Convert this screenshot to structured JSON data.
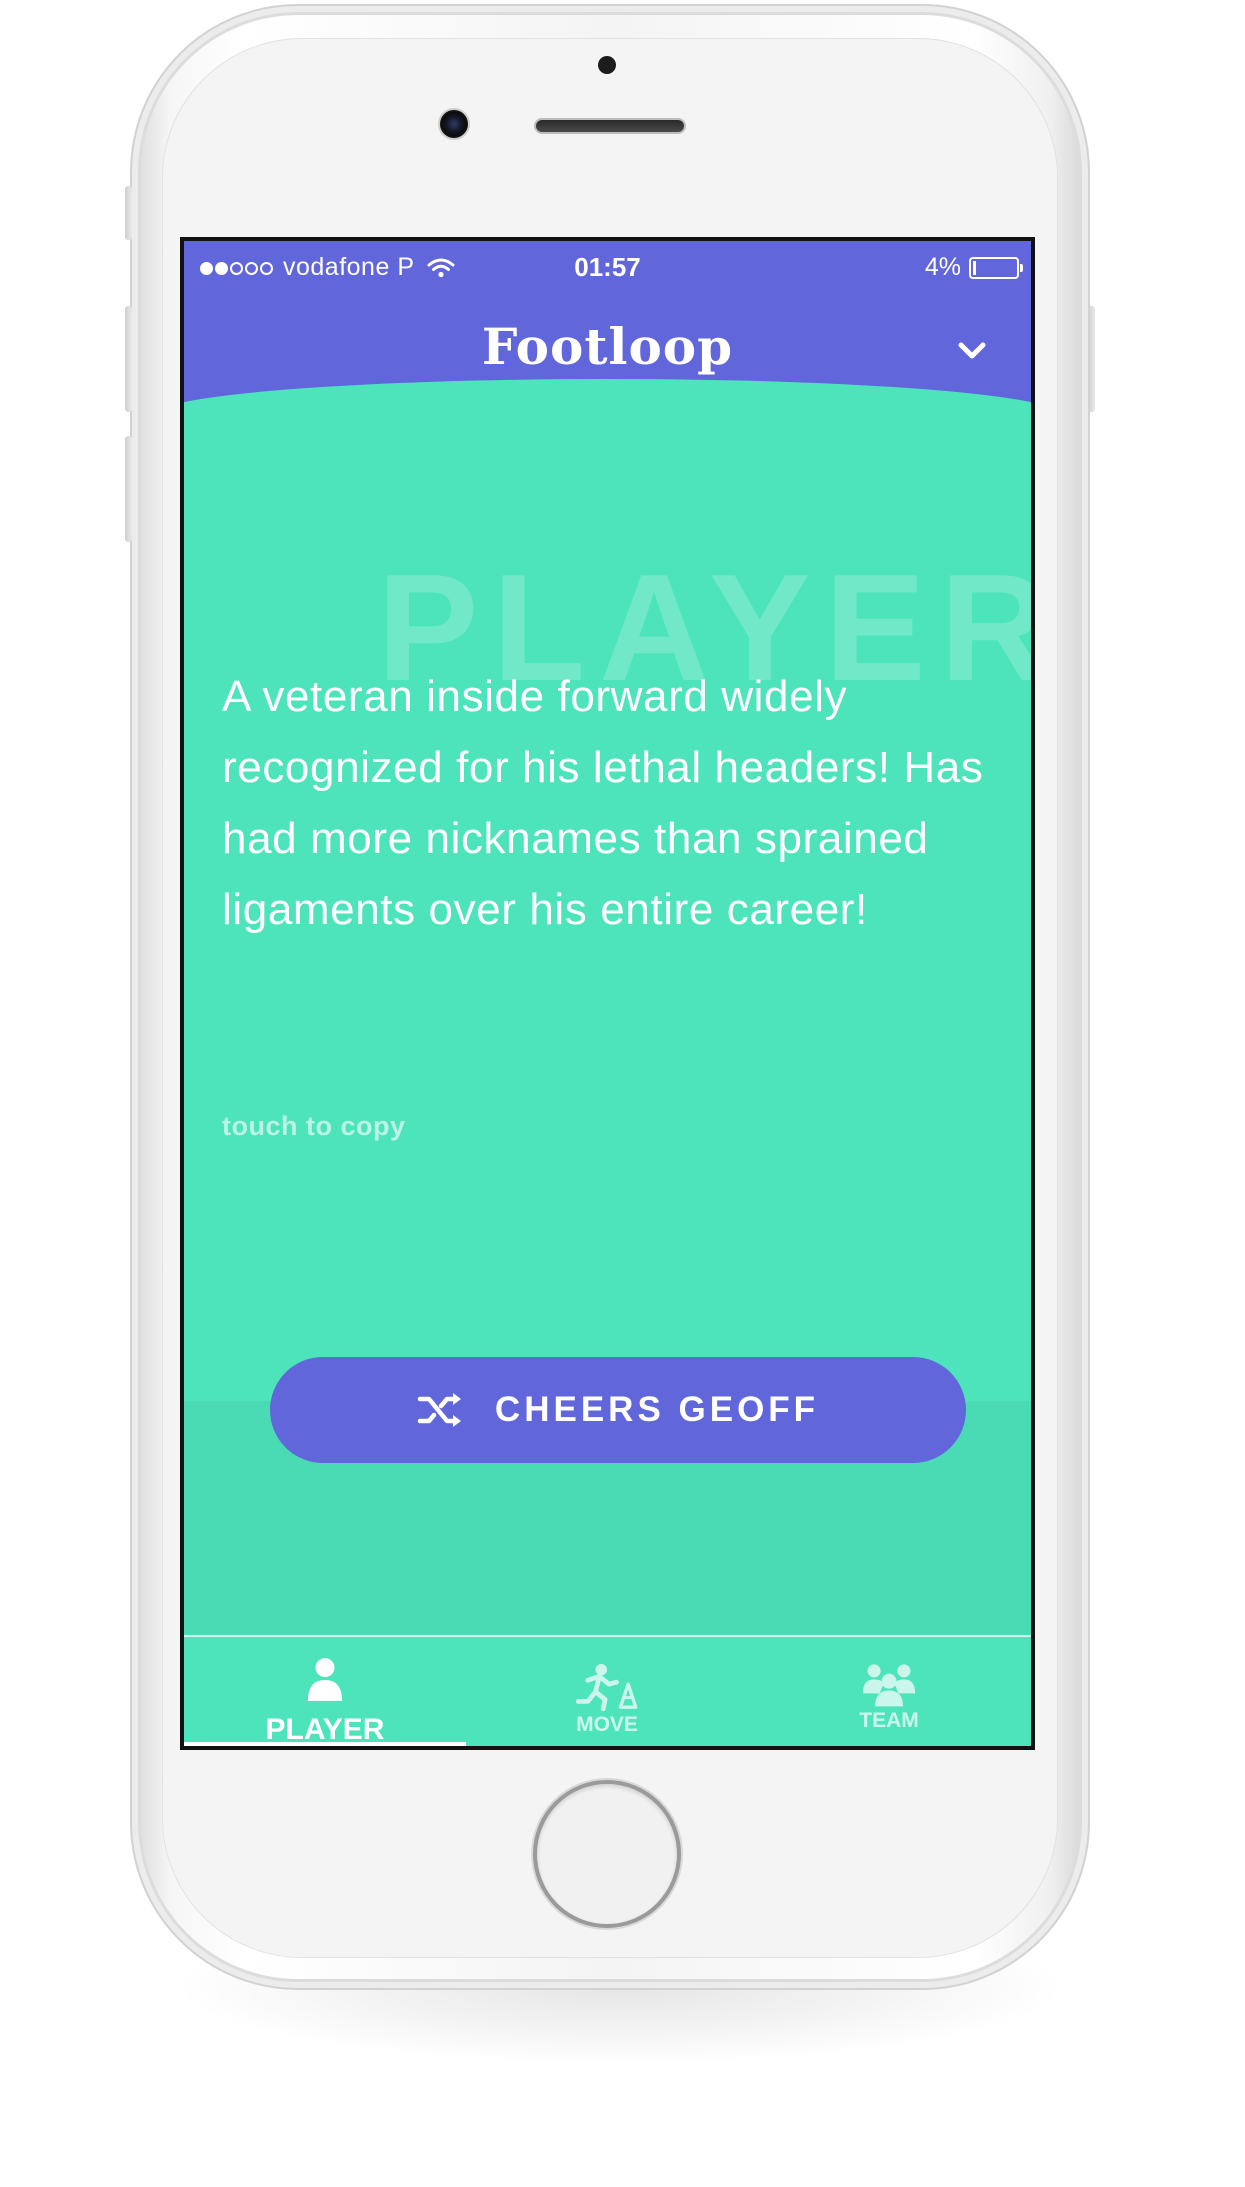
{
  "status_bar": {
    "carrier": "vodafone P",
    "signal_bars_filled": 2,
    "signal_bars_total": 5,
    "time": "01:57",
    "battery_percent": "4%",
    "battery_level": 0.04
  },
  "header": {
    "title": "Footloop",
    "menu_icon": "chevron-down-icon"
  },
  "card": {
    "watermark": "PLAYER",
    "description": "A veteran inside forward widely recognized for his lethal headers! Has had more nicknames than sprained ligaments over his entire career!",
    "copy_hint": "touch to copy"
  },
  "action_button": {
    "icon": "shuffle-icon",
    "label": "CHEERS GEOFF"
  },
  "tabs": [
    {
      "label": "PLAYER",
      "icon": "person-icon",
      "active": true
    },
    {
      "label": "MOVE",
      "icon": "running-player-icon",
      "active": false
    },
    {
      "label": "TEAM",
      "icon": "group-icon",
      "active": false
    }
  ],
  "colors": {
    "primary": "#6166da",
    "background": "#4de4bc",
    "text": "#ffffff"
  }
}
